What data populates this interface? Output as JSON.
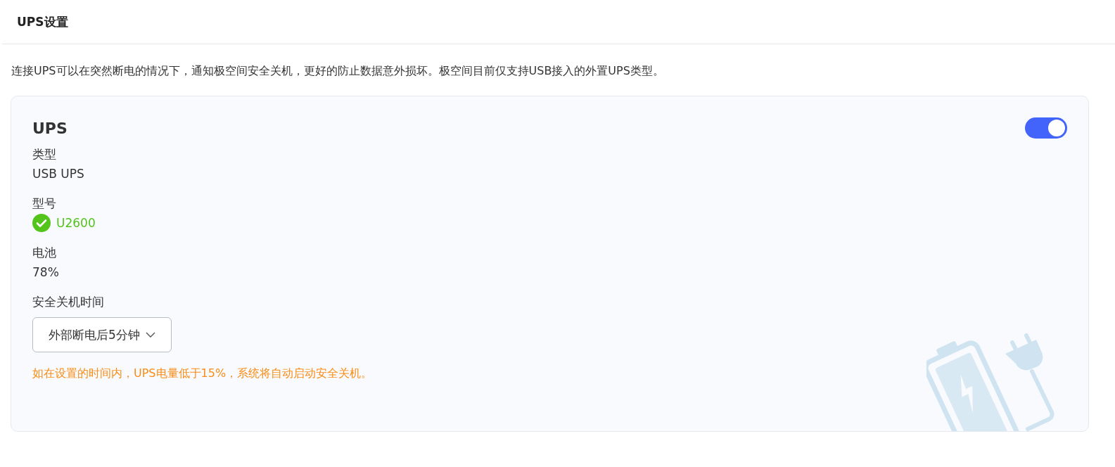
{
  "title": "UPS设置",
  "description": "连接UPS可以在突然断电的情况下，通知极空间安全关机，更好的防止数据意外损坏。极空间目前仅支持USB接入的外置UPS类型。",
  "card": {
    "title": "UPS",
    "on": true,
    "fields": [
      {
        "kind": "text",
        "label": "类型",
        "value": "USB UPS"
      },
      {
        "kind": "status",
        "label": "型号",
        "value": "U2600",
        "ok": true
      },
      {
        "kind": "text",
        "label": "电池",
        "value": "78%"
      }
    ],
    "shutdown": {
      "label": "安全关机时间",
      "value": "外部断电后5分钟"
    },
    "warning": "如在设置的时间内，UPS电量低于15%，系统将自动启动安全关机。"
  }
}
